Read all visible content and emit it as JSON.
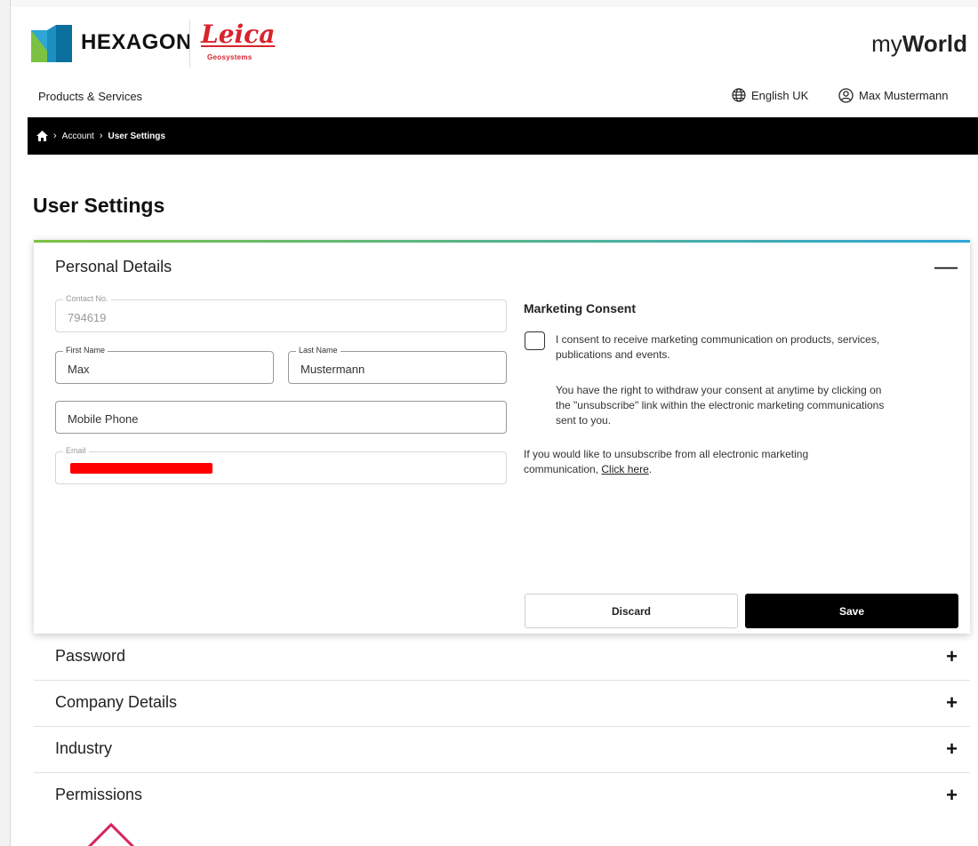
{
  "header": {
    "brand": "HEXAGON",
    "partner_brand": "Leica",
    "partner_sub": "Geosystems",
    "app_name_light": "my",
    "app_name_bold": "World"
  },
  "utility": {
    "products_label": "Products & Services",
    "language": "English UK",
    "user_name": "Max Mustermann"
  },
  "breadcrumb": {
    "items": [
      "Account",
      "User Settings"
    ]
  },
  "page": {
    "title": "User Settings"
  },
  "personal_details": {
    "title": "Personal Details",
    "contact_no": {
      "label": "Contact No.",
      "value": "794619"
    },
    "first_name": {
      "label": "First Name",
      "value": "Max"
    },
    "last_name": {
      "label": "Last Name",
      "value": "Mustermann"
    },
    "mobile_phone": {
      "placeholder": "Mobile Phone"
    },
    "email": {
      "label": "Email"
    },
    "marketing": {
      "title": "Marketing Consent",
      "consent_text": "I consent to receive marketing communication on products, services, publications and events.",
      "rights_text": "You have the right to withdraw your consent at anytime by clicking on the \"unsubscribe\" link within the electronic marketing communications sent to you.",
      "unsub_text": "If you would like to unsubscribe from all electronic marketing communication,",
      "unsub_link": "Click here"
    },
    "discard_label": "Discard",
    "save_label": "Save"
  },
  "sections": [
    "Password",
    "Company Details",
    "Industry",
    "Permissions"
  ],
  "colors": {
    "accent_start": "#7cc242",
    "accent_end": "#2ea6d6",
    "leica_red": "#d9232d",
    "breadcrumb_bg": "#000000"
  }
}
